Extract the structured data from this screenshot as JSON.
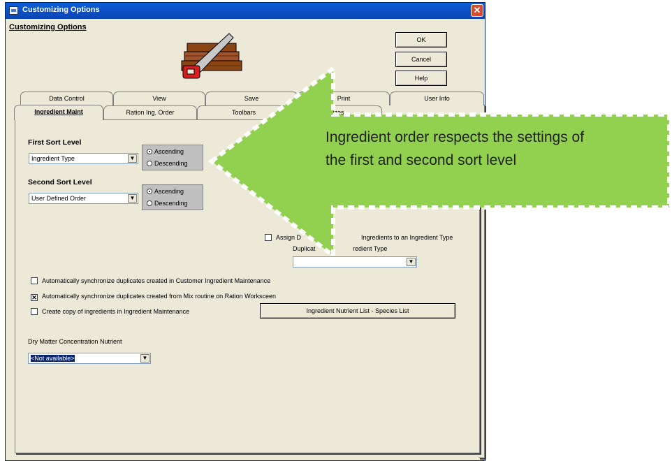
{
  "window": {
    "title": "Customizing Options",
    "close_label": "✕"
  },
  "frame_title": "Customizing Options",
  "buttons": {
    "ok": "OK",
    "cancel": "Cancel",
    "help": "Help"
  },
  "tabs_back": [
    "Data Control",
    "View",
    "Save",
    "Print",
    "User Info"
  ],
  "tabs_front": [
    "Ingredient Maint",
    "Ration Ing. Order",
    "Toolbars",
    "Sizes"
  ],
  "first_sort": {
    "label": "First Sort Level",
    "value": "Ingredient Type",
    "ascending": "Ascending",
    "descending": "Descending",
    "selected": "Ascending"
  },
  "second_sort": {
    "label": "Second Sort Level",
    "value": "User Defined Order",
    "ascending": "Ascending",
    "descending": "Descending",
    "selected": "Ascending"
  },
  "assign": {
    "label_a": "Assign D",
    "label_b": "Ingredients to an Ingredient Type",
    "checked": false
  },
  "duplicate_type": {
    "label_a": "Duplicat",
    "label_b": "redient Type",
    "value": ""
  },
  "options": [
    {
      "label": "Automatically synchronize duplicates created in Customer Ingredient Maintenance",
      "checked": false
    },
    {
      "label": "Automatically synchronize duplicates created from Mix routine on Ration Worksceen",
      "checked": true
    },
    {
      "label": "Create copy of ingredients in Ingredient Maintenance",
      "checked": false
    }
  ],
  "nutrient_list_button": "Ingredient Nutrient List - Species List",
  "dry_matter": {
    "label": "Dry Matter Concentration Nutrient",
    "value": "<Not available>"
  },
  "callout": {
    "line1": "Ingredient order respects the settings of",
    "line2": "the first and second sort level",
    "fill_color": "#92d050",
    "border_color": "#ffffff"
  },
  "icons": {
    "logo": "saw-and-lumber-icon"
  }
}
